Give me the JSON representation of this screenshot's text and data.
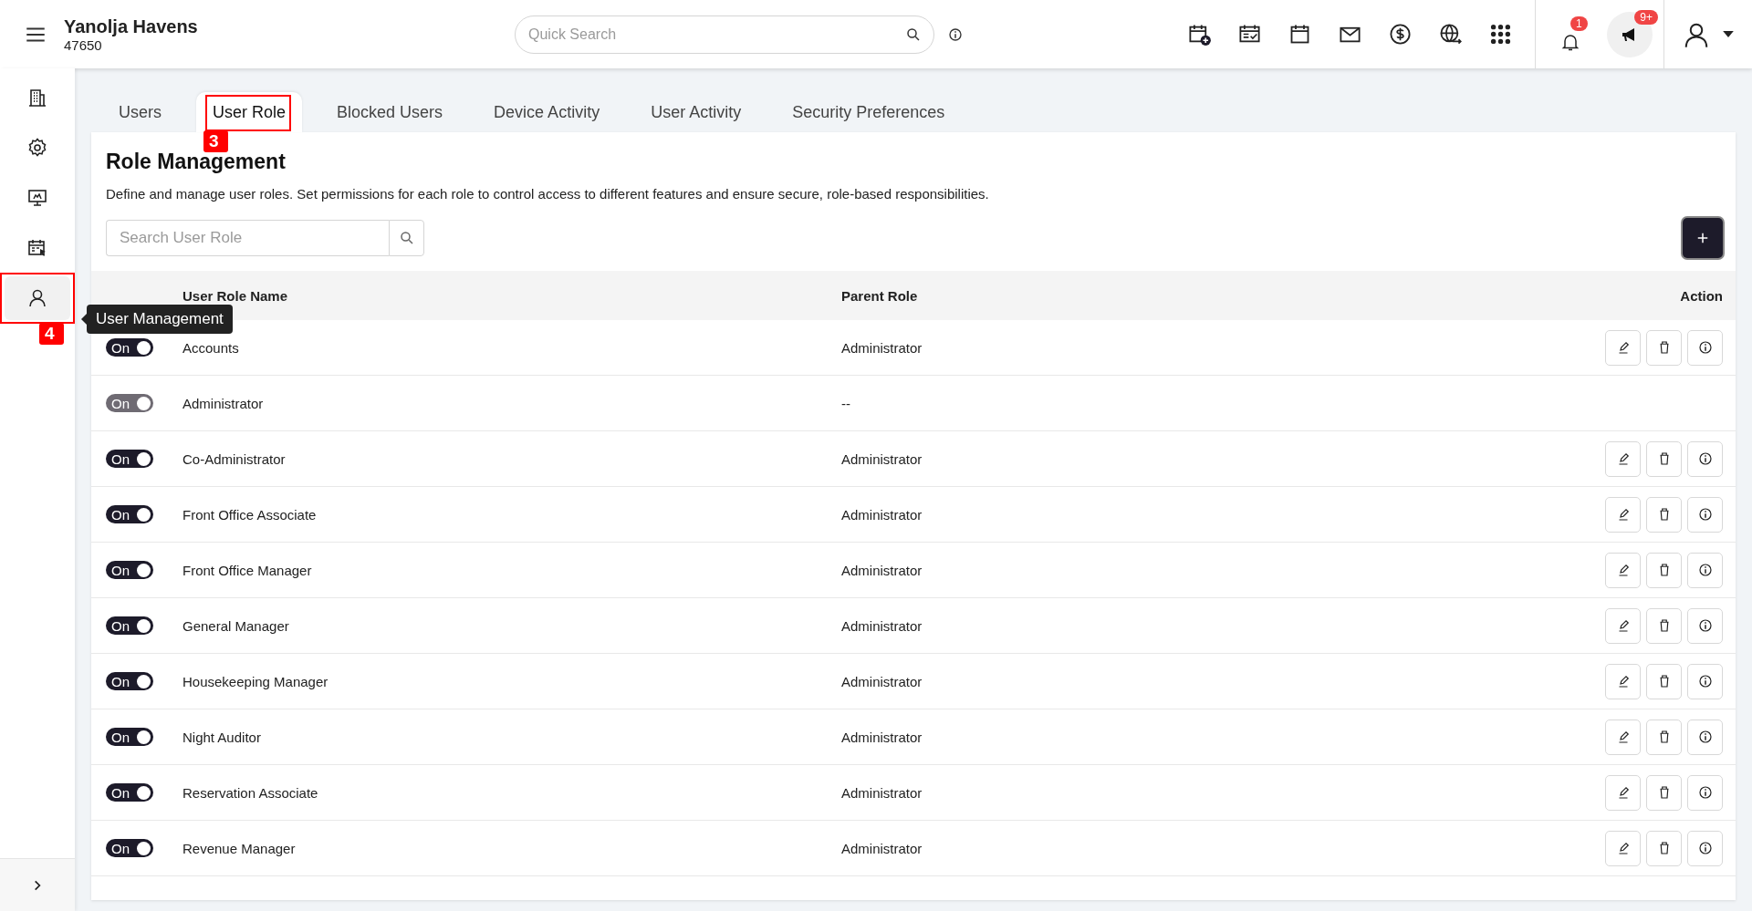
{
  "header": {
    "property_name": "Yanolja Havens",
    "property_id": "47650",
    "search": {
      "placeholder": "Quick Search"
    },
    "notifications": {
      "badge": "1"
    },
    "announcements": {
      "badge": "9+"
    }
  },
  "sidebar": {
    "items": [
      {
        "kind": "building",
        "selected": false
      },
      {
        "kind": "gear",
        "selected": false
      },
      {
        "kind": "monitor",
        "selected": false
      },
      {
        "kind": "calendar",
        "selected": false
      },
      {
        "kind": "user",
        "selected": true,
        "tooltip": "User Management",
        "callout": "4"
      }
    ]
  },
  "tabs": [
    {
      "label": "Users",
      "selected": false
    },
    {
      "label": "User Role",
      "selected": true,
      "callout": "3"
    },
    {
      "label": "Blocked Users",
      "selected": false
    },
    {
      "label": "Device Activity",
      "selected": false
    },
    {
      "label": "User Activity",
      "selected": false
    },
    {
      "label": "Security Preferences",
      "selected": false
    }
  ],
  "page": {
    "title": "Role Management",
    "description": "Define and manage user roles. Set permissions for each role to control access to different features and ensure secure, role-based responsibilities.",
    "search": {
      "placeholder": "Search User Role"
    }
  },
  "table": {
    "columns": [
      "User Role Name",
      "Parent Role",
      "Action"
    ],
    "rows": [
      {
        "status": "On",
        "on": true,
        "disabled": false,
        "name": "Accounts",
        "parent": "Administrator",
        "editable": true
      },
      {
        "status": "On",
        "on": true,
        "disabled": true,
        "name": "Administrator",
        "parent": "--",
        "editable": false
      },
      {
        "status": "On",
        "on": true,
        "disabled": false,
        "name": "Co-Administrator",
        "parent": "Administrator",
        "editable": true
      },
      {
        "status": "On",
        "on": true,
        "disabled": false,
        "name": "Front Office Associate",
        "parent": "Administrator",
        "editable": true
      },
      {
        "status": "On",
        "on": true,
        "disabled": false,
        "name": "Front Office Manager",
        "parent": "Administrator",
        "editable": true
      },
      {
        "status": "On",
        "on": true,
        "disabled": false,
        "name": "General Manager",
        "parent": "Administrator",
        "editable": true
      },
      {
        "status": "On",
        "on": true,
        "disabled": false,
        "name": "Housekeeping Manager",
        "parent": "Administrator",
        "editable": true
      },
      {
        "status": "On",
        "on": true,
        "disabled": false,
        "name": "Night Auditor",
        "parent": "Administrator",
        "editable": true
      },
      {
        "status": "On",
        "on": true,
        "disabled": false,
        "name": "Reservation Associate",
        "parent": "Administrator",
        "editable": true
      },
      {
        "status": "On",
        "on": true,
        "disabled": false,
        "name": "Revenue Manager",
        "parent": "Administrator",
        "editable": true
      }
    ]
  }
}
